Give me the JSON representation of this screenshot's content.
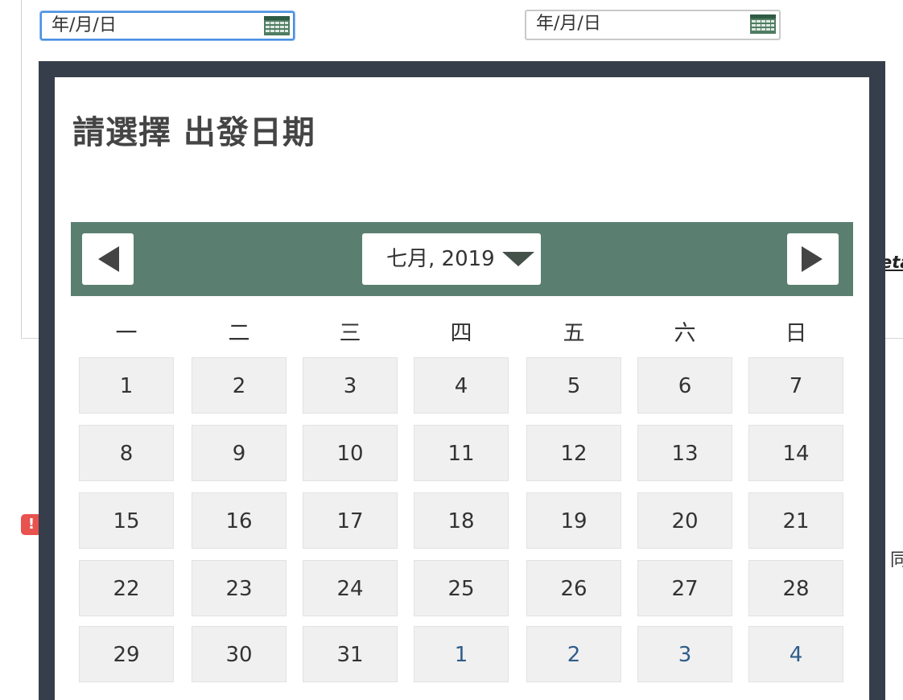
{
  "inputs": {
    "departure_placeholder": "年/月/日",
    "return_placeholder": "年/月/日"
  },
  "background": {
    "link_fragment": "eta",
    "alert_mark": "!",
    "partial_char": "同"
  },
  "calendar": {
    "title": "請選擇 出發日期",
    "month_label": "七月, 2019",
    "weekdays": [
      "一",
      "二",
      "三",
      "四",
      "五",
      "六",
      "日"
    ],
    "weeks": [
      [
        {
          "day": "1",
          "other": false
        },
        {
          "day": "2",
          "other": false
        },
        {
          "day": "3",
          "other": false
        },
        {
          "day": "4",
          "other": false
        },
        {
          "day": "5",
          "other": false
        },
        {
          "day": "6",
          "other": false
        },
        {
          "day": "7",
          "other": false
        }
      ],
      [
        {
          "day": "8",
          "other": false
        },
        {
          "day": "9",
          "other": false
        },
        {
          "day": "10",
          "other": false
        },
        {
          "day": "11",
          "other": false
        },
        {
          "day": "12",
          "other": false
        },
        {
          "day": "13",
          "other": false
        },
        {
          "day": "14",
          "other": false
        }
      ],
      [
        {
          "day": "15",
          "other": false
        },
        {
          "day": "16",
          "other": false
        },
        {
          "day": "17",
          "other": false
        },
        {
          "day": "18",
          "other": false
        },
        {
          "day": "19",
          "other": false
        },
        {
          "day": "20",
          "other": false
        },
        {
          "day": "21",
          "other": false
        }
      ],
      [
        {
          "day": "22",
          "other": false
        },
        {
          "day": "23",
          "other": false
        },
        {
          "day": "24",
          "other": false
        },
        {
          "day": "25",
          "other": false
        },
        {
          "day": "26",
          "other": false
        },
        {
          "day": "27",
          "other": false
        },
        {
          "day": "28",
          "other": false
        }
      ],
      [
        {
          "day": "29",
          "other": false
        },
        {
          "day": "30",
          "other": false
        },
        {
          "day": "31",
          "other": false
        },
        {
          "day": "1",
          "other": true
        },
        {
          "day": "2",
          "other": true
        },
        {
          "day": "3",
          "other": true
        },
        {
          "day": "4",
          "other": true
        }
      ]
    ]
  },
  "colors": {
    "header_bg": "#5a7f70",
    "modal_border": "#373e4b",
    "cell_bg": "#f0f0f0",
    "other_month_text": "#2f5d8a",
    "focus_ring": "#4a90e2"
  }
}
